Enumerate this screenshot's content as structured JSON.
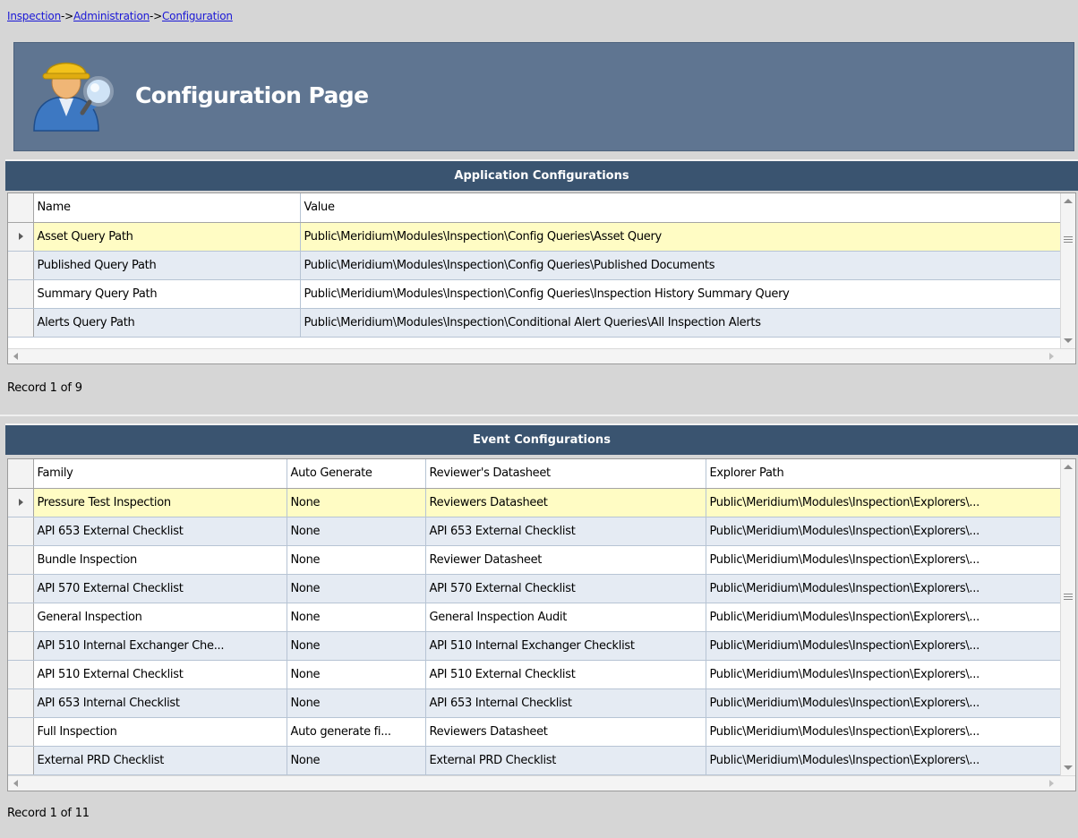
{
  "breadcrumb": {
    "items": [
      "Inspection",
      "Administration",
      "Configuration"
    ],
    "separator": "->"
  },
  "header": {
    "title": "Configuration Page",
    "icon": "inspector-magnifier-icon"
  },
  "app_config": {
    "title": "Application Configurations",
    "columns": [
      "Name",
      "Value"
    ],
    "rows": [
      [
        "Asset Query Path",
        "Public\\Meridium\\Modules\\Inspection\\Config Queries\\Asset Query"
      ],
      [
        "Published Query Path",
        "Public\\Meridium\\Modules\\Inspection\\Config Queries\\Published Documents"
      ],
      [
        "Summary Query Path",
        "Public\\Meridium\\Modules\\Inspection\\Config Queries\\Inspection History Summary Query"
      ],
      [
        "Alerts Query Path",
        "Public\\Meridium\\Modules\\Inspection\\Conditional Alert Queries\\All Inspection Alerts"
      ]
    ],
    "record": "Record 1 of 9"
  },
  "event_config": {
    "title": "Event Configurations",
    "columns": [
      "Family",
      "Auto Generate",
      "Reviewer's Datasheet",
      "Explorer Path"
    ],
    "rows": [
      [
        "Pressure Test Inspection",
        "None",
        "Reviewers Datasheet",
        "Public\\Meridium\\Modules\\Inspection\\Explorers\\..."
      ],
      [
        "API 653 External Checklist",
        "None",
        "API 653 External Checklist",
        "Public\\Meridium\\Modules\\Inspection\\Explorers\\..."
      ],
      [
        "Bundle Inspection",
        "None",
        "Reviewer Datasheet",
        "Public\\Meridium\\Modules\\Inspection\\Explorers\\..."
      ],
      [
        "API 570 External Checklist",
        "None",
        "API 570 External Checklist",
        "Public\\Meridium\\Modules\\Inspection\\Explorers\\..."
      ],
      [
        "General Inspection",
        "None",
        "General Inspection Audit",
        "Public\\Meridium\\Modules\\Inspection\\Explorers\\..."
      ],
      [
        "API 510 Internal  Exchanger Che...",
        "None",
        "API 510 Internal  Exchanger Checklist",
        "Public\\Meridium\\Modules\\Inspection\\Explorers\\..."
      ],
      [
        "API 510 External Checklist",
        "None",
        "API 510 External Checklist",
        "Public\\Meridium\\Modules\\Inspection\\Explorers\\..."
      ],
      [
        "API 653 Internal Checklist",
        "None",
        "API 653 Internal Checklist",
        "Public\\Meridium\\Modules\\Inspection\\Explorers\\..."
      ],
      [
        "Full Inspection",
        "Auto generate fi...",
        "Reviewers Datasheet",
        "Public\\Meridium\\Modules\\Inspection\\Explorers\\..."
      ],
      [
        "External PRD Checklist",
        "None",
        "External PRD Checklist",
        "Public\\Meridium\\Modules\\Inspection\\Explorers\\..."
      ]
    ],
    "record": "Record 1 of 11"
  },
  "colors": {
    "header_bg": "#5f7591",
    "section_bg": "#3a5470",
    "active_row": "#fffcc4",
    "alt_row": "#e5ebf3",
    "link": "#1a17d6"
  }
}
